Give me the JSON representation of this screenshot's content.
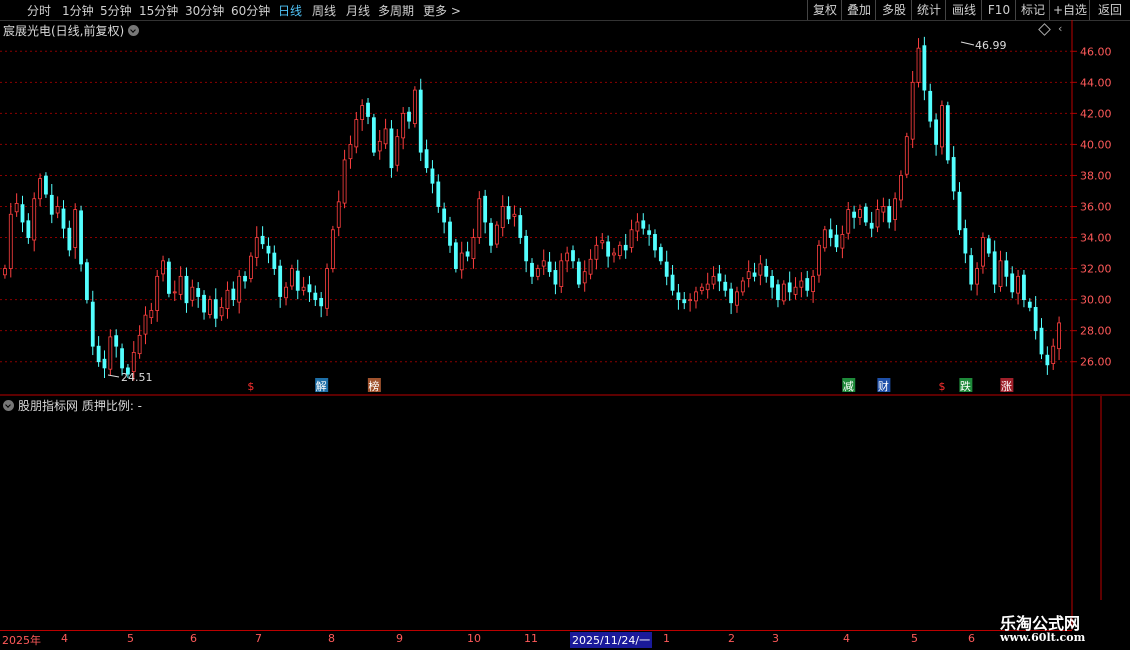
{
  "toolbar": {
    "periods": [
      {
        "label": "分时",
        "active": false
      },
      {
        "label": "1分钟",
        "active": false
      },
      {
        "label": "5分钟",
        "active": false
      },
      {
        "label": "15分钟",
        "active": false
      },
      {
        "label": "30分钟",
        "active": false
      },
      {
        "label": "60分钟",
        "active": false
      },
      {
        "label": "日线",
        "active": true
      },
      {
        "label": "周线",
        "active": false
      },
      {
        "label": "月线",
        "active": false
      },
      {
        "label": "多周期",
        "active": false
      },
      {
        "label": "更多 >",
        "active": false
      }
    ],
    "buttons": [
      "复权",
      "叠加",
      "多股",
      "统计",
      "画线",
      "F10",
      "标记",
      "+自选",
      "返回"
    ]
  },
  "main": {
    "title": "宸展光电(日线,前复权)",
    "max_label": "46.99",
    "min_label": "24.51"
  },
  "sub": {
    "title": "股朋指标网 质押比例: -"
  },
  "timeaxis": {
    "labels": [
      "2025年",
      "4",
      "5",
      "6",
      "7",
      "8",
      "9",
      "10",
      "11",
      "2025/11/24/一",
      "1",
      "2",
      "3",
      "4",
      "5",
      "6"
    ]
  },
  "watermark": {
    "line1": "乐淘公式网",
    "line2": "www.60lt.com"
  },
  "colors": {
    "up": "#ff4040",
    "down": "#54ffff",
    "grid": "#8b0000",
    "axis": "#b00000"
  },
  "chart_data": {
    "type": "candlestick",
    "ylim": [
      24.5,
      47.5
    ],
    "yticks": [
      26,
      28,
      30,
      32,
      34,
      36,
      38,
      40,
      42,
      44,
      46
    ],
    "ytick_labels": [
      "26.00",
      "28.00",
      "30.00",
      "32.00",
      "34.00",
      "36.00",
      "38.00",
      "40.00",
      "42.00",
      "44.00",
      "46.00"
    ],
    "markers": [
      {
        "label": "$",
        "color": "#ff3030",
        "bg": "none",
        "index": 42
      },
      {
        "label": "解",
        "color": "#ffffff",
        "bg": "#1e6fa8",
        "index": 54
      },
      {
        "label": "榜",
        "color": "#ffffff",
        "bg": "#a0522d",
        "index": 63
      },
      {
        "label": "减",
        "color": "#ffffff",
        "bg": "#1e8a3a",
        "index": 144
      },
      {
        "label": "财",
        "color": "#ffffff",
        "bg": "#1e4fa8",
        "index": 150
      },
      {
        "label": "$",
        "color": "#ff3030",
        "bg": "none",
        "index": 160
      },
      {
        "label": "跌",
        "color": "#ffffff",
        "bg": "#1e8a3a",
        "index": 164
      },
      {
        "label": "涨",
        "color": "#ffffff",
        "bg": "#a0202a",
        "index": 171
      }
    ],
    "closes": [
      32.0,
      35.5,
      36.2,
      35.0,
      34.0,
      36.5,
      37.8,
      36.8,
      35.5,
      36.0,
      34.6,
      33.2,
      35.8,
      32.3,
      30.0,
      27.0,
      26.0,
      25.6,
      27.6,
      27.0,
      25.6,
      25.2,
      26.6,
      27.7,
      29.0,
      29.3,
      31.5,
      32.5,
      30.4,
      30.5,
      31.5,
      29.8,
      30.8,
      30.2,
      29.2,
      30.0,
      28.8,
      29.5,
      30.6,
      30.0,
      31.5,
      31.2,
      32.8,
      34.0,
      33.6,
      33.0,
      32.0,
      30.2,
      30.8,
      32.0,
      30.6,
      30.8,
      30.5,
      30.0,
      29.6,
      32.0,
      34.5,
      36.3,
      39.0,
      40.0,
      41.6,
      42.5,
      41.8,
      39.5,
      40.2,
      41.0,
      38.5,
      40.5,
      42.0,
      41.5,
      43.5,
      39.5,
      38.5,
      37.5,
      36.0,
      35.0,
      33.5,
      32.0,
      33.0,
      32.8,
      34.0,
      36.5,
      35.0,
      33.5,
      34.8,
      36.0,
      35.2,
      35.5,
      34.0,
      32.5,
      31.5,
      32.0,
      32.5,
      31.8,
      31.0,
      32.5,
      33.0,
      32.5,
      31.0,
      31.8,
      32.6,
      33.5,
      33.8,
      32.8,
      33.0,
      33.5,
      33.2,
      34.5,
      35.0,
      34.6,
      34.2,
      33.2,
      32.5,
      31.5,
      30.6,
      30.0,
      29.8,
      30.0,
      30.5,
      30.8,
      31.0,
      31.5,
      31.2,
      30.6,
      29.8,
      30.5,
      31.2,
      31.8,
      31.5,
      32.3,
      31.5,
      30.8,
      30.0,
      31.0,
      30.5,
      30.8,
      31.2,
      30.6,
      31.5,
      33.5,
      34.5,
      34.0,
      33.4,
      34.2,
      35.8,
      35.3,
      35.8,
      35.0,
      34.6,
      35.8,
      36.0,
      35.0,
      36.5,
      38.0,
      40.5,
      44.0,
      46.2,
      43.5,
      41.5,
      40.0,
      42.5,
      39.0,
      37.0,
      34.5,
      33.0,
      31.0,
      32.0,
      34.0,
      33.0,
      31.0,
      32.5,
      31.5,
      30.5,
      31.5,
      30.0,
      29.5,
      28.0,
      26.5,
      25.8,
      27.0,
      28.5
    ]
  }
}
